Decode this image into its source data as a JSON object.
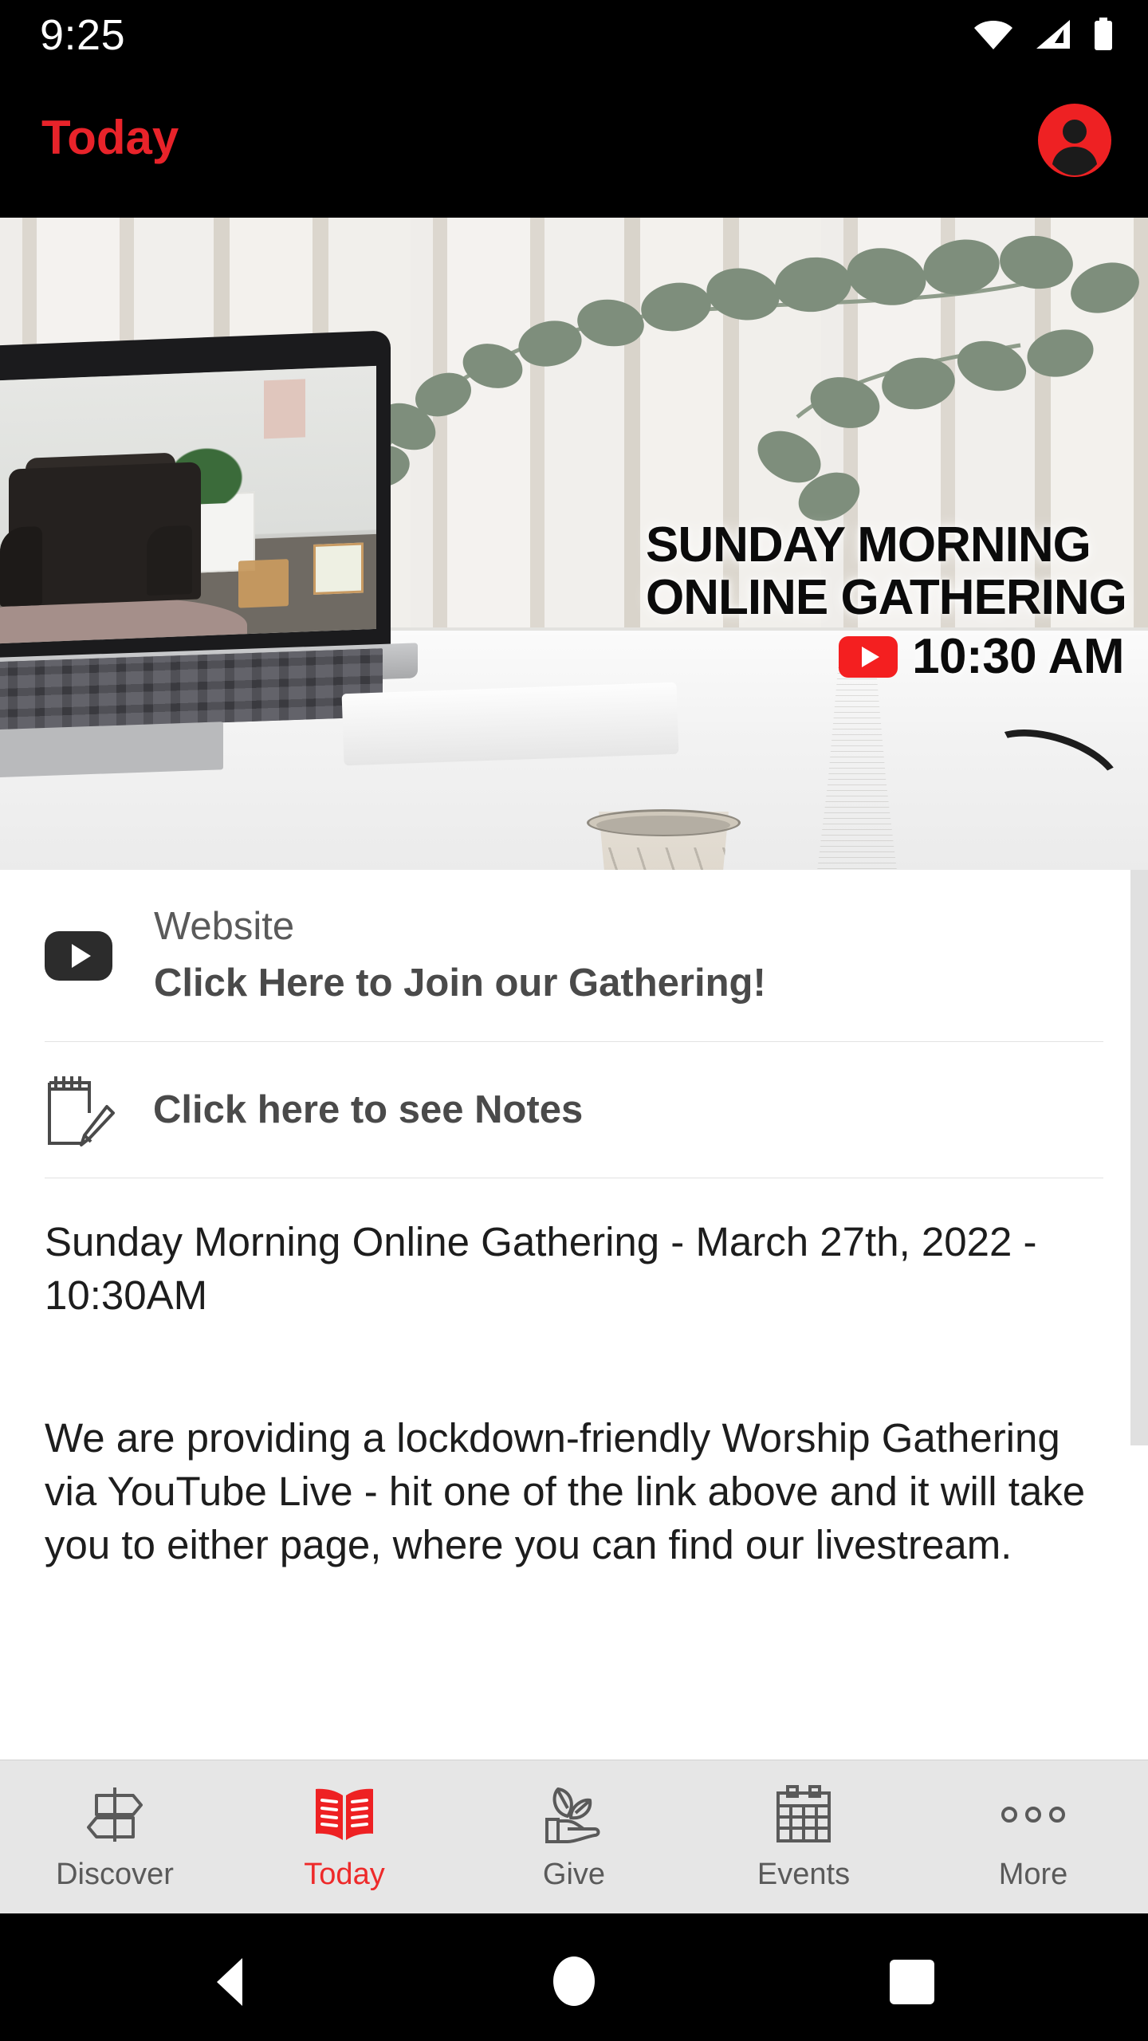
{
  "colors": {
    "brand_red": "#EE2A2A",
    "title_red": "#E8232A",
    "youtube_red": "#F41F20",
    "appbar_bg": "#000000",
    "tabbar_bg": "#E6E6E6",
    "content_bg": "#FFFFFF",
    "text_dark": "#1D1D1D",
    "text_gray": "#4A4A4A",
    "divider": "#E2E2E2",
    "scrollbar": "#E0E0E0"
  },
  "status_bar": {
    "time": "9:25",
    "icons": [
      "wifi-icon",
      "cellular-signal-icon",
      "battery-icon"
    ]
  },
  "app_bar": {
    "title": "Today",
    "avatar_icon": "account-circle-icon"
  },
  "hero": {
    "overlay_line1": "SUNDAY MORNING",
    "overlay_line2": "ONLINE GATHERING",
    "overlay_badge_icon": "youtube-icon",
    "overlay_time": "10:30 AM",
    "scene_description": "Laptop on white desk showing living room with leather armchair; ceramic pot on wooden saucer and white ribbed vase with eucalyptus branches"
  },
  "links": [
    {
      "icon": "youtube-play-icon",
      "sublabel": "Website",
      "label": "Click Here to Join our Gathering!"
    },
    {
      "icon": "notepad-pencil-icon",
      "label": "Click here to see Notes"
    }
  ],
  "post": {
    "title": "Sunday Morning Online Gathering - March 27th, 2022 - 10:30AM",
    "body": "We are providing a lockdown-friendly Worship Gathering via YouTube Live - hit one of the link above and it will take you to either page, where you can find our livestream."
  },
  "tab_bar": {
    "active_index": 1,
    "tabs": [
      {
        "label": "Discover",
        "icon": "signpost-icon"
      },
      {
        "label": "Today",
        "icon": "open-book-icon"
      },
      {
        "label": "Give",
        "icon": "hand-with-sprout-icon"
      },
      {
        "label": "Events",
        "icon": "calendar-icon"
      },
      {
        "label": "More",
        "icon": "three-dots-icon"
      }
    ]
  },
  "android_nav": {
    "back": "back-triangle-icon",
    "home": "home-circle-icon",
    "recents": "recents-square-icon"
  }
}
